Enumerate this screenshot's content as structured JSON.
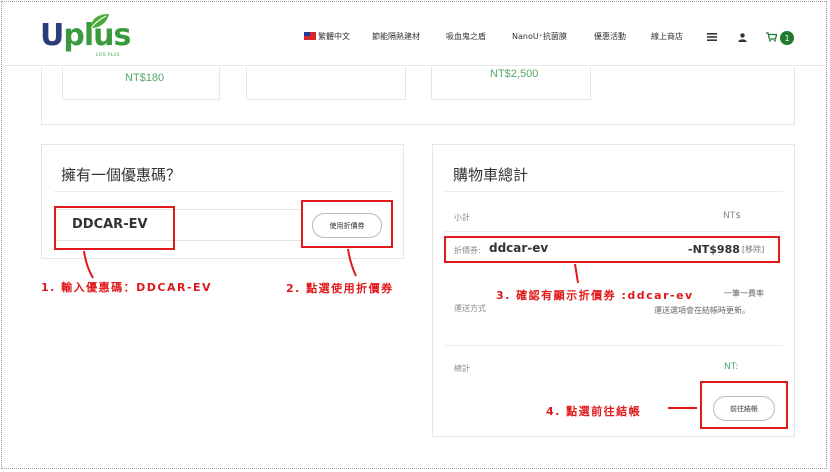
{
  "brand": {
    "logo_text": "Uplus",
    "logo_sub": "LIFE PLUS"
  },
  "nav": {
    "items": [
      "繁體中文",
      "節能隔熱建材",
      "吸血鬼之盾",
      "NanoU⁺抗菌膜",
      "優惠活動",
      "線上商店"
    ],
    "cart_count": "1"
  },
  "products": {
    "prices": [
      "NT$180",
      "NT$2,500"
    ]
  },
  "coupon": {
    "title": "擁有一個優惠碼？",
    "code": "DDCAR-EV",
    "apply_label": "使用折價券"
  },
  "cart_totals": {
    "title": "購物車總計",
    "subtotal_label": "小計",
    "subtotal_value": "NT$",
    "discount_label": "折價券:",
    "discount_code": "ddcar-ev",
    "discount_value": "-NT$988",
    "remove_label": "[移除]",
    "shipping_label": "運送方式",
    "shipping_value_1": "一筆一費率",
    "shipping_value_2": "運送選項會在結帳時更新。",
    "total_label": "總計",
    "total_value": "NT:",
    "checkout_label": "前往結帳"
  },
  "annotations": {
    "step1": "1. 輸入優惠碼：DDCAR-EV",
    "step2": "2. 點選使用折價券",
    "step3": "3. 確認有顯示折價券 :ddcar-ev",
    "step4": "4. 點選前往結帳"
  },
  "colors": {
    "annotation_red": "#e0191b",
    "brand_green": "#3a9a3e",
    "brand_navy": "#2c3e7a",
    "price_green": "#55a868"
  }
}
